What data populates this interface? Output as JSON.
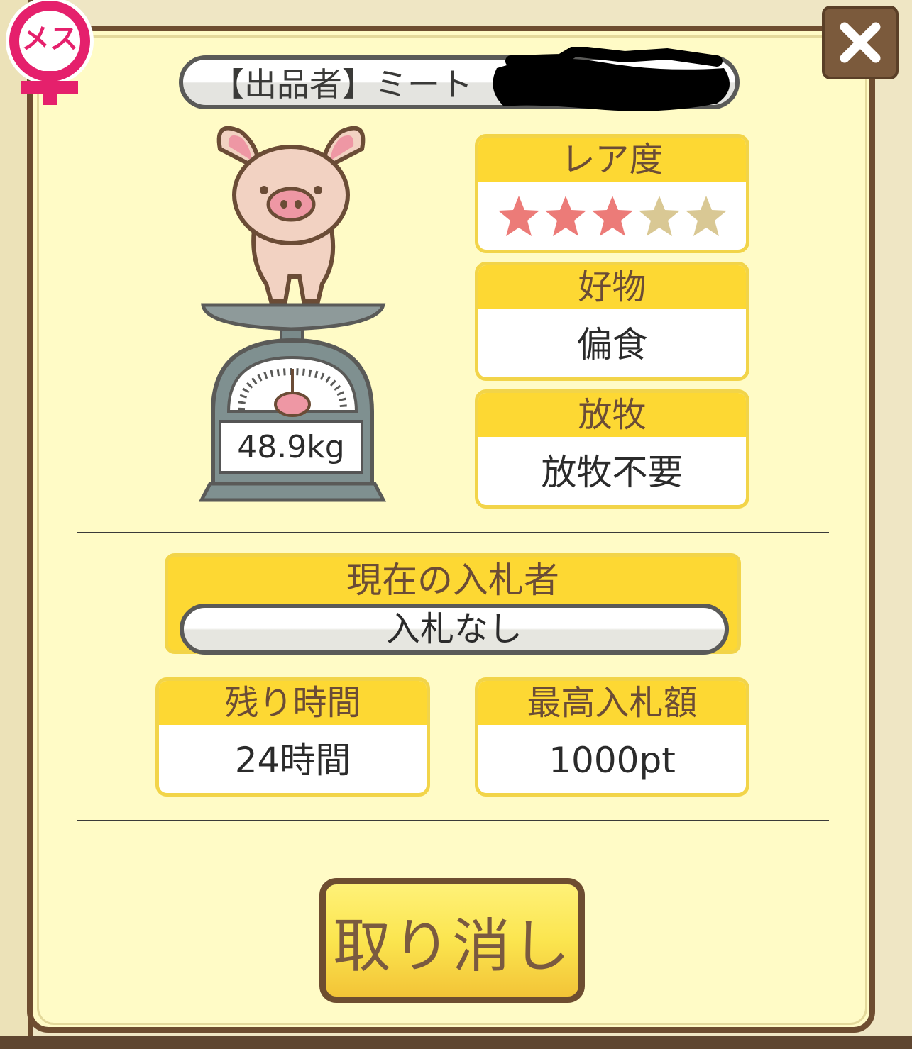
{
  "gender_badge": {
    "label": "メス",
    "color": "#e5206c",
    "icon": "female-symbol"
  },
  "close_button": {
    "icon": "close-icon"
  },
  "seller": {
    "label": "【出品者】ミート"
  },
  "pig": {
    "weight": "48.9kg"
  },
  "rarity": {
    "label": "レア度",
    "stars_filled": 3,
    "stars_total": 5,
    "filled_color": "#ec7b78",
    "empty_color": "#d9c894"
  },
  "favorite_food": {
    "label": "好物",
    "value": "偏食"
  },
  "grazing": {
    "label": "放牧",
    "value": "放牧不要"
  },
  "current_bidder": {
    "label": "現在の入札者",
    "value": "入札なし"
  },
  "time_left": {
    "label": "残り時間",
    "value": "24時間"
  },
  "highest_bid": {
    "label": "最高入札額",
    "value": "1000pt"
  },
  "cancel_button": {
    "label": "取り消し"
  }
}
